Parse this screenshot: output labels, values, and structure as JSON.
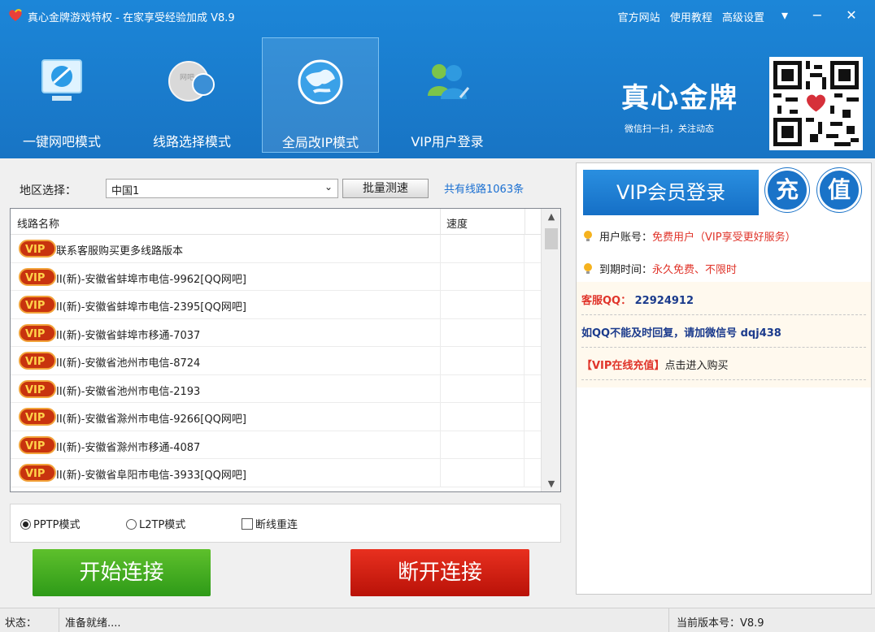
{
  "window": {
    "title": "真心金牌游戏特权 - 在家享受经验加成 V8.9",
    "links": [
      "官方网站",
      "使用教程",
      "高级设置"
    ],
    "controls": {
      "menu": "▾",
      "minimize": "−",
      "close": "✕"
    }
  },
  "modes": [
    {
      "label": "一键网吧模式",
      "icon": "monitor-icon",
      "active": false
    },
    {
      "label": "线路选择模式",
      "icon": "netbar-globe-icon",
      "active": false
    },
    {
      "label": "全局改IP模式",
      "icon": "globe-icon",
      "active": true
    },
    {
      "label": "VIP用户登录",
      "icon": "users-icon",
      "active": false
    }
  ],
  "brand": {
    "name": "真心金牌",
    "subtitle": "微信扫一扫，关注动态"
  },
  "region": {
    "label": "地区选择：",
    "selected": "中国1",
    "speedtest_label": "批量测速",
    "line_count": "共有线路1063条"
  },
  "list": {
    "col_name": "线路名称",
    "col_speed": "速度",
    "rows": [
      "联系客服购买更多线路版本",
      "II(新)-安徽省蚌埠市电信-9962[QQ网吧]",
      "II(新)-安徽省蚌埠市电信-2395[QQ网吧]",
      "II(新)-安徽省蚌埠市移通-7037",
      "II(新)-安徽省池州市电信-8724",
      "II(新)-安徽省池州市电信-2193",
      "II(新)-安徽省滁州市电信-9266[QQ网吧]",
      "II(新)-安徽省滁州市移通-4087",
      "II(新)-安徽省阜阳市电信-3933[QQ网吧]"
    ]
  },
  "options": {
    "pptp": "PPTP模式",
    "l2tp": "L2TP模式",
    "reconnect": "断线重连",
    "selected": "pptp"
  },
  "buttons": {
    "connect": "开始连接",
    "disconnect": "断开连接"
  },
  "account": {
    "vip_login": "VIP会员登录",
    "recharge_1": "充",
    "recharge_2": "值",
    "user_label": "用户账号：",
    "user_value": "免费用户（VIP享受更好服务）",
    "expire_label": "到期时间：",
    "expire_value": "永久免费、不限时"
  },
  "notices": {
    "qq_label": "客服QQ：",
    "qq_value": "22924912",
    "wechat_text": "如QQ不能及时回复，请加微信号 dqj438",
    "vip_online": "【VIP在线充值】",
    "vip_online_action": "点击进入购买"
  },
  "status": {
    "label": "状态：",
    "value": "准备就绪....",
    "version_label": "当前版本号：V8.9"
  },
  "colors": {
    "header_blue": "#1874c4",
    "accent_blue": "#1a6fd1",
    "connect_green": "#3aa81e",
    "disconnect_red": "#d0200f",
    "highlight_red": "#e0342a",
    "notice_navy": "#1a3a8c"
  }
}
